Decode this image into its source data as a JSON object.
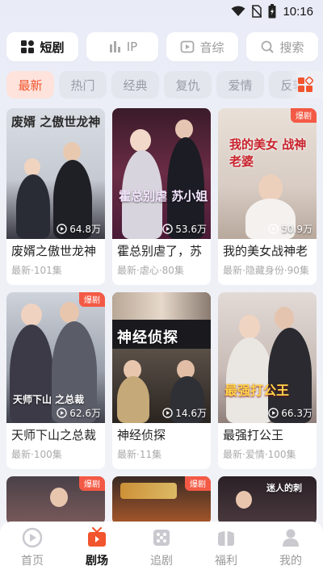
{
  "status_bar": {
    "time": "10:16"
  },
  "categories": [
    {
      "label": "短剧",
      "icon": "grid-icon",
      "active": true
    },
    {
      "label": "IP",
      "icon": "bars-icon",
      "active": false
    },
    {
      "label": "音综",
      "icon": "play-square-icon",
      "active": false
    },
    {
      "label": "搜索",
      "icon": "search-icon",
      "active": false
    }
  ],
  "tags": [
    "最新",
    "热门",
    "经典",
    "复仇",
    "爱情",
    "反转"
  ],
  "hot_badge": "爆剧",
  "cards": [
    {
      "title": "废婿之傲世龙神",
      "meta": "最新·101集",
      "plays": "64.8万",
      "art": "废婿 之傲世龙神",
      "hot": false
    },
    {
      "title": "霍总别虐了，苏",
      "meta": "最新·虐心·80集",
      "plays": "53.6万",
      "art": "霍总别虐 苏小姐",
      "hot": false
    },
    {
      "title": "我的美女战神老",
      "meta": "最新·隐藏身份·90集",
      "plays": "50.9万",
      "art": "我的美女 战神老婆",
      "hot": true
    },
    {
      "title": "天师下山之总裁",
      "meta": "最新·100集",
      "plays": "62.6万",
      "art": "天师下山 之总裁",
      "hot": true
    },
    {
      "title": "神经侦探",
      "meta": "最新·11集",
      "plays": "14.6万",
      "art": "神经侦探",
      "hot": false
    },
    {
      "title": "最强打公王",
      "meta": "最新·爱情·100集",
      "plays": "66.3万",
      "art": "最强打公王",
      "hot": false
    }
  ],
  "peek_cards": [
    {
      "hot": true,
      "art": ""
    },
    {
      "hot": true,
      "art": ""
    },
    {
      "hot": false,
      "art": "迷人的刺"
    }
  ],
  "bottom_nav": [
    {
      "label": "首页",
      "icon": "home-play-icon",
      "active": false
    },
    {
      "label": "剧场",
      "icon": "theater-icon",
      "active": true
    },
    {
      "label": "追剧",
      "icon": "follow-icon",
      "active": false
    },
    {
      "label": "福利",
      "icon": "gift-icon",
      "active": false
    },
    {
      "label": "我的",
      "icon": "user-icon",
      "active": false
    }
  ],
  "colors": {
    "accent": "#f2542d",
    "hot_badge": "#f35a45",
    "tag_active_bg": "#fde3dc"
  }
}
